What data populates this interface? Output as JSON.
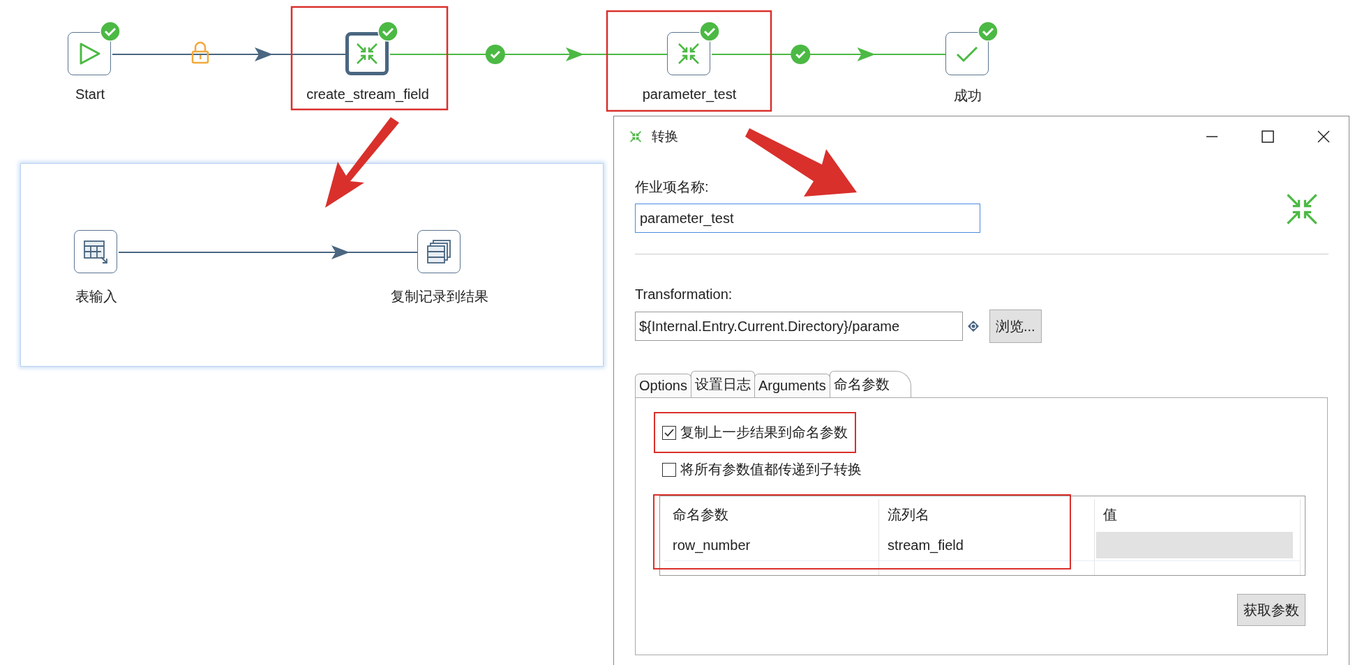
{
  "job": {
    "nodes": [
      {
        "label": "Start",
        "kind": "start",
        "selected": false,
        "succeeded": true
      },
      {
        "label": "create_stream_field",
        "kind": "transformation",
        "selected": true,
        "succeeded": true
      },
      {
        "label": "parameter_test",
        "kind": "transformation",
        "selected": false,
        "succeeded": true
      },
      {
        "label": "成功",
        "kind": "success",
        "selected": false,
        "succeeded": true
      }
    ],
    "hops": [
      {
        "kind": "unconditional"
      },
      {
        "kind": "on_success"
      },
      {
        "kind": "on_success"
      }
    ]
  },
  "subflow": {
    "nodes": [
      {
        "label": "表输入",
        "kind": "table_input"
      },
      {
        "label": "复制记录到结果",
        "kind": "copy_rows"
      }
    ],
    "hops": [
      {
        "kind": "normal"
      }
    ]
  },
  "dialog": {
    "title": "转换",
    "name_label": "作业项名称:",
    "name_value": "parameter_test",
    "transformation_label": "Transformation:",
    "transformation_value": "${Internal.Entry.Current.Directory}/parame",
    "browse_button": "浏览...",
    "tabs": [
      {
        "label": "Options",
        "selected": false
      },
      {
        "label": "设置日志",
        "selected": false
      },
      {
        "label": "Arguments",
        "selected": false
      },
      {
        "label": "命名参数",
        "selected": true
      }
    ],
    "checkboxes": [
      {
        "label": "复制上一步结果到命名参数",
        "checked": true
      },
      {
        "label": "将所有参数值都传递到子转换",
        "checked": false
      }
    ],
    "table": {
      "columns": [
        "命名参数",
        "流列名",
        "值"
      ],
      "rows": [
        {
          "parameter": "row_number",
          "stream_column": "stream_field"
        }
      ]
    },
    "get_params_button": "获取参数"
  }
}
